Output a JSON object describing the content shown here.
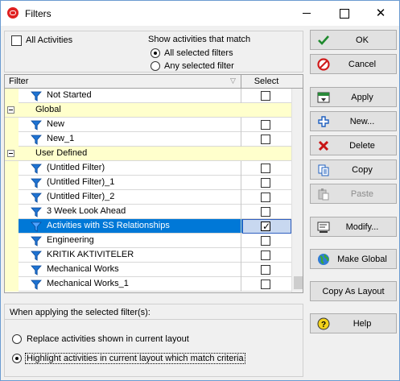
{
  "window": {
    "title": "Filters"
  },
  "top_options": {
    "all_activities_label": "All Activities",
    "show_match_label": "Show activities that match",
    "all_selected_label": "All selected filters",
    "any_selected_label": "Any selected filter",
    "selected_match": "All selected filters"
  },
  "grid": {
    "col_filter": "Filter",
    "col_select": "Select",
    "rows": [
      {
        "type": "filter",
        "label": "Not Started",
        "checked": false
      },
      {
        "type": "group",
        "label": "Global"
      },
      {
        "type": "filter",
        "label": "New",
        "checked": false
      },
      {
        "type": "filter",
        "label": "New_1",
        "checked": false
      },
      {
        "type": "group",
        "label": "User Defined"
      },
      {
        "type": "filter",
        "label": "(Untitled Filter)",
        "checked": false
      },
      {
        "type": "filter",
        "label": "(Untitled Filter)_1",
        "checked": false
      },
      {
        "type": "filter",
        "label": "(Untitled Filter)_2",
        "checked": false
      },
      {
        "type": "filter",
        "label": "3 Week Look Ahead",
        "checked": false
      },
      {
        "type": "filter",
        "label": "Activities with SS Relationships",
        "checked": true,
        "selected": true
      },
      {
        "type": "filter",
        "label": "Engineering",
        "checked": false
      },
      {
        "type": "filter",
        "label": "KRITIK AKTIVITELER",
        "checked": false
      },
      {
        "type": "filter",
        "label": "Mechanical Works",
        "checked": false
      },
      {
        "type": "filter",
        "label": "Mechanical Works_1",
        "checked": false
      }
    ]
  },
  "bottom_options": {
    "heading": "When applying the selected filter(s):",
    "replace_label": "Replace activities shown in current layout",
    "highlight_label": "Highlight activities in current layout which match criteria",
    "selected": "highlight"
  },
  "buttons": {
    "ok": "OK",
    "cancel": "Cancel",
    "apply": "Apply",
    "new": "New...",
    "delete": "Delete",
    "copy": "Copy",
    "paste": "Paste",
    "modify": "Modify...",
    "make_global": "Make Global",
    "copy_as_layout": "Copy As Layout",
    "help": "Help"
  },
  "colors": {
    "selection": "#0078d7",
    "group_band": "#ffffcc",
    "filter_icon": "#1e73d2"
  }
}
